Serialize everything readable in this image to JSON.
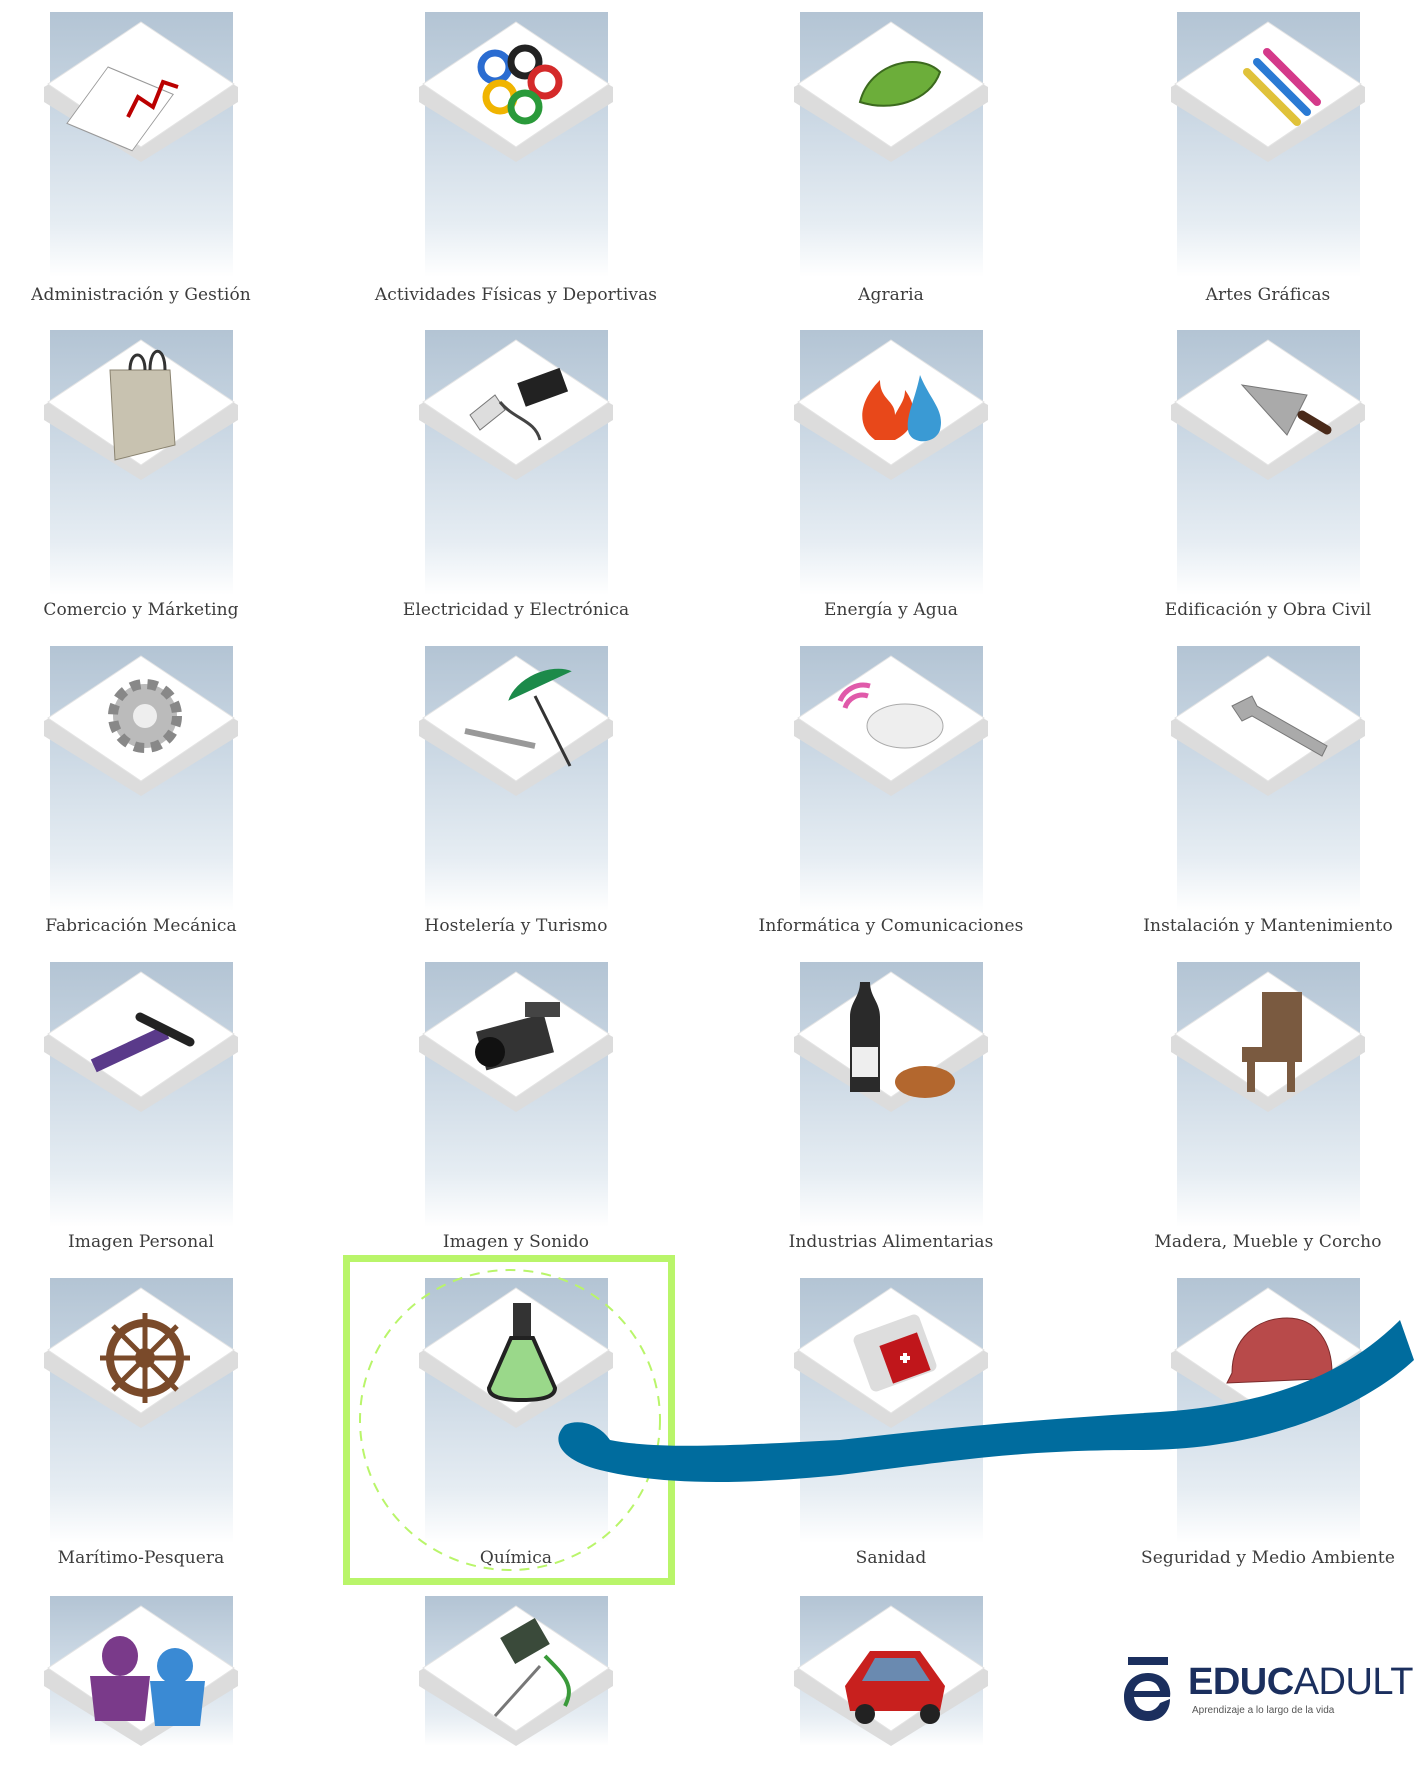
{
  "categories": [
    {
      "label": "Administración y Gestión",
      "icon": "chart-graph-icon"
    },
    {
      "label": "Actividades Físicas y Deportivas",
      "icon": "olympic-rings-icon"
    },
    {
      "label": "Agraria",
      "icon": "leaf-icon"
    },
    {
      "label": "Artes Gráficas",
      "icon": "pencils-icon"
    },
    {
      "label": "Comercio y Márketing",
      "icon": "shopping-bag-icon"
    },
    {
      "label": "Electricidad y Electrónica",
      "icon": "plug-chip-icon"
    },
    {
      "label": "Energía y Agua",
      "icon": "fire-water-icon"
    },
    {
      "label": "Edificación y Obra Civil",
      "icon": "trowel-icon"
    },
    {
      "label": "Fabricación Mecánica",
      "icon": "gear-icon"
    },
    {
      "label": "Hostelería y Turismo",
      "icon": "umbrella-fork-icon"
    },
    {
      "label": "Informática y Comunicaciones",
      "icon": "wireless-mouse-icon"
    },
    {
      "label": "Instalación y Mantenimiento",
      "icon": "wrench-icon"
    },
    {
      "label": "Imagen Personal",
      "icon": "comb-brush-icon"
    },
    {
      "label": "Imagen y Sonido",
      "icon": "video-camera-icon"
    },
    {
      "label": "Industrias Alimentarias",
      "icon": "wine-bread-icon"
    },
    {
      "label": "Madera, Mueble y Corcho",
      "icon": "chair-icon"
    },
    {
      "label": "Marítimo-Pesquera",
      "icon": "ship-wheel-icon"
    },
    {
      "label": "Química",
      "icon": "flask-icon"
    },
    {
      "label": "Sanidad",
      "icon": "first-aid-kit-icon"
    },
    {
      "label": "Seguridad y Medio Ambiente",
      "icon": "hard-hat-icon"
    },
    {
      "label": "",
      "icon": "puppets-icon"
    },
    {
      "label": "",
      "icon": "thread-needle-icon"
    },
    {
      "label": "",
      "icon": "red-car-icon"
    }
  ],
  "highlighted": "Química",
  "highlight_color": "#b9f56a",
  "arrow_color": "#006c9e",
  "logo": {
    "brand_bold": "EDUC",
    "brand_light": "ADULT",
    "tagline": "Aprendizaje a lo largo de la vida"
  }
}
